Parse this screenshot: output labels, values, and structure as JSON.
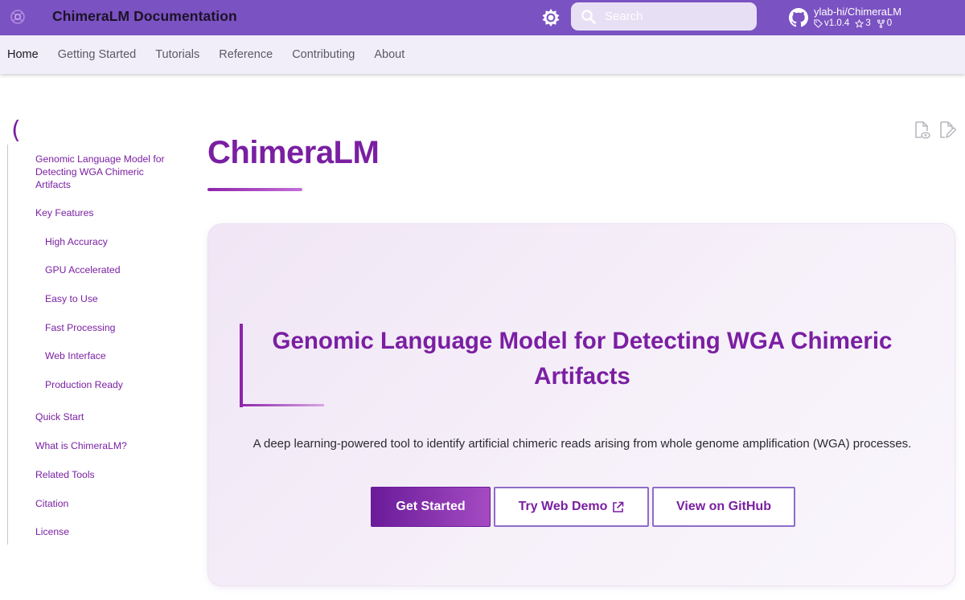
{
  "header": {
    "site_title": "ChimeraLM Documentation",
    "search_placeholder": "Search",
    "repo": {
      "name": "ylab-hi/ChimeraLM",
      "version": "v1.0.4",
      "stars": "3",
      "forks": "0"
    }
  },
  "tabs": [
    {
      "label": "Home",
      "active": true
    },
    {
      "label": "Getting Started",
      "active": false
    },
    {
      "label": "Tutorials",
      "active": false
    },
    {
      "label": "Reference",
      "active": false
    },
    {
      "label": "Contributing",
      "active": false
    },
    {
      "label": "About",
      "active": false
    }
  ],
  "toc": {
    "bracket": "(",
    "items": [
      {
        "label": "Genomic Language Model for Detecting WGA Chimeric Artifacts",
        "level": 1
      },
      {
        "label": "Key Features",
        "level": 1
      },
      {
        "label": "High Accuracy",
        "level": 2
      },
      {
        "label": "GPU Accelerated",
        "level": 2
      },
      {
        "label": "Easy to Use",
        "level": 2
      },
      {
        "label": "Fast Processing",
        "level": 2
      },
      {
        "label": "Web Interface",
        "level": 2
      },
      {
        "label": "Production Ready",
        "level": 2
      },
      {
        "label": "Quick Start",
        "level": 1
      },
      {
        "label": "What is ChimeraLM?",
        "level": 1
      },
      {
        "label": "Related Tools",
        "level": 1
      },
      {
        "label": "Citation",
        "level": 1
      },
      {
        "label": "License",
        "level": 1
      }
    ]
  },
  "main": {
    "title": "ChimeraLM",
    "hero": {
      "heading": "Genomic Language Model for Detecting WGA Chimeric Artifacts",
      "description": "A deep learning-powered tool to identify artificial chimeric reads arising from whole genome amplification (WGA) processes.",
      "buttons": {
        "primary": "Get Started",
        "demo": "Try Web Demo",
        "github": "View on GitHub"
      }
    }
  },
  "colors": {
    "header_bg": "#7b52c2",
    "accent": "#7a1fa2",
    "tabs_bg": "#f1eefa",
    "hero_bg": "#f3ebf7"
  },
  "icons": [
    "logo-icon",
    "theme-toggle-icon",
    "search-icon",
    "github-icon",
    "tag-icon",
    "star-icon",
    "fork-icon",
    "view-source-icon",
    "edit-page-icon",
    "external-link-icon"
  ]
}
